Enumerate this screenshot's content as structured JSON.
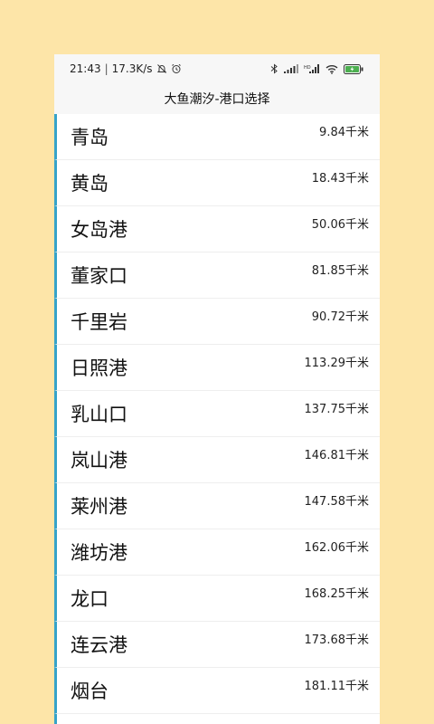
{
  "status": {
    "time": "21:43",
    "separator": "|",
    "speed": "17.3K/s",
    "icons_left": [
      "mute-bell-icon",
      "alarm-icon"
    ],
    "icons_right": [
      "bluetooth-icon",
      "signal-icon",
      "hd-signal-icon",
      "wifi-icon",
      "battery-charging-icon"
    ],
    "battery_color": "#4caf50"
  },
  "header": {
    "title": "大鱼潮汐-港口选择"
  },
  "accent_color": "#36a3c9",
  "ports": [
    {
      "name": "青岛",
      "distance": "9.84千米"
    },
    {
      "name": "黄岛",
      "distance": "18.43千米"
    },
    {
      "name": "女岛港",
      "distance": "50.06千米"
    },
    {
      "name": "董家口",
      "distance": "81.85千米"
    },
    {
      "name": "千里岩",
      "distance": "90.72千米"
    },
    {
      "name": "日照港",
      "distance": "113.29千米"
    },
    {
      "name": "乳山口",
      "distance": "137.75千米"
    },
    {
      "name": "岚山港",
      "distance": "146.81千米"
    },
    {
      "name": "莱州港",
      "distance": "147.58千米"
    },
    {
      "name": "潍坊港",
      "distance": "162.06千米"
    },
    {
      "name": "龙口",
      "distance": "168.25千米"
    },
    {
      "name": "连云港",
      "distance": "173.68千米"
    },
    {
      "name": "烟台",
      "distance": "181.11千米"
    }
  ]
}
